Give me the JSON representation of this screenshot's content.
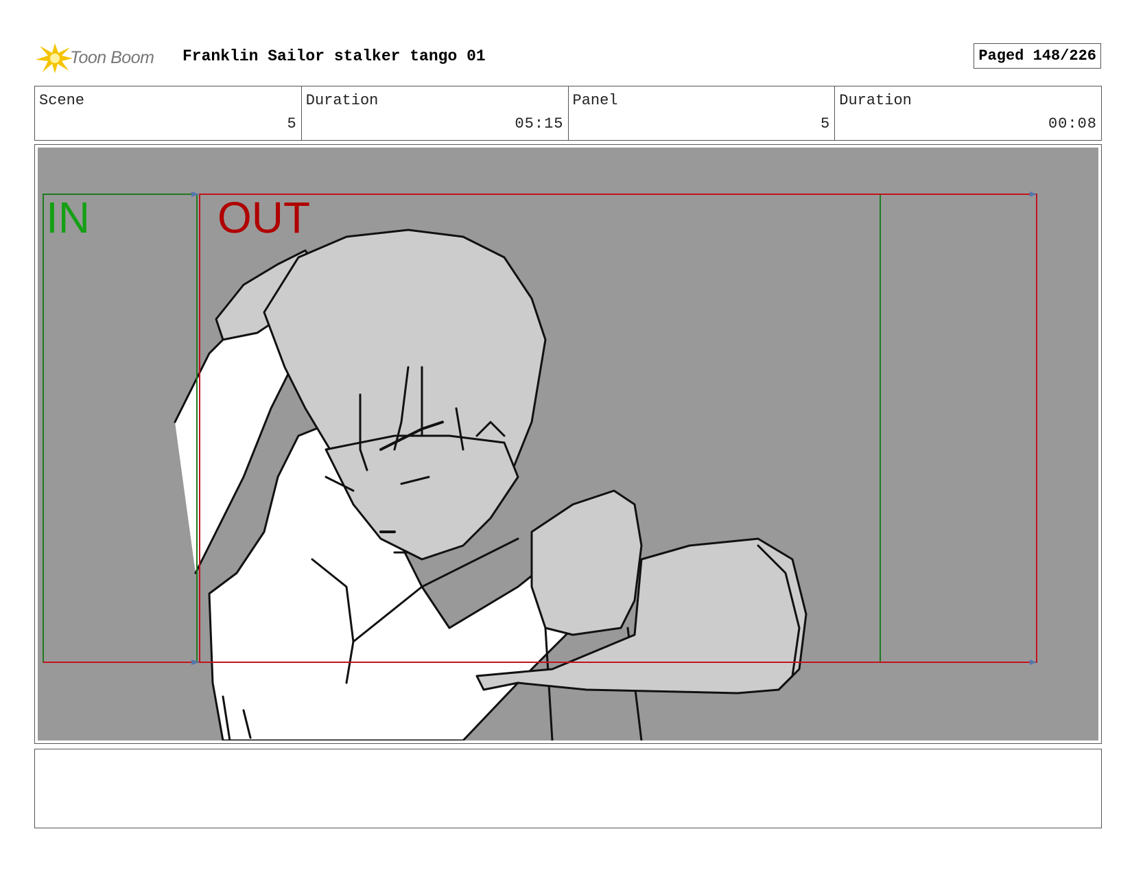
{
  "header": {
    "logo_text": "Toon Boom",
    "logo_icon": "toon-boom-starburst-icon",
    "project_title": "Franklin Sailor stalker tango 01",
    "page_counter": "Paged 148/226"
  },
  "info": {
    "scene_label": "Scene",
    "scene_value": "5",
    "scene_duration_label": "Duration",
    "scene_duration_value": "05:15",
    "panel_label": "Panel",
    "panel_value": "5",
    "panel_duration_label": "Duration",
    "panel_duration_value": "00:08"
  },
  "panel": {
    "in_label": "IN",
    "out_label": "OUT",
    "colors": {
      "background": "#999999",
      "in_frame": "#1f7a1f",
      "out_frame": "#c0141e",
      "in_text": "#15a015",
      "out_text": "#b00000"
    }
  },
  "notes": {
    "text": ""
  }
}
